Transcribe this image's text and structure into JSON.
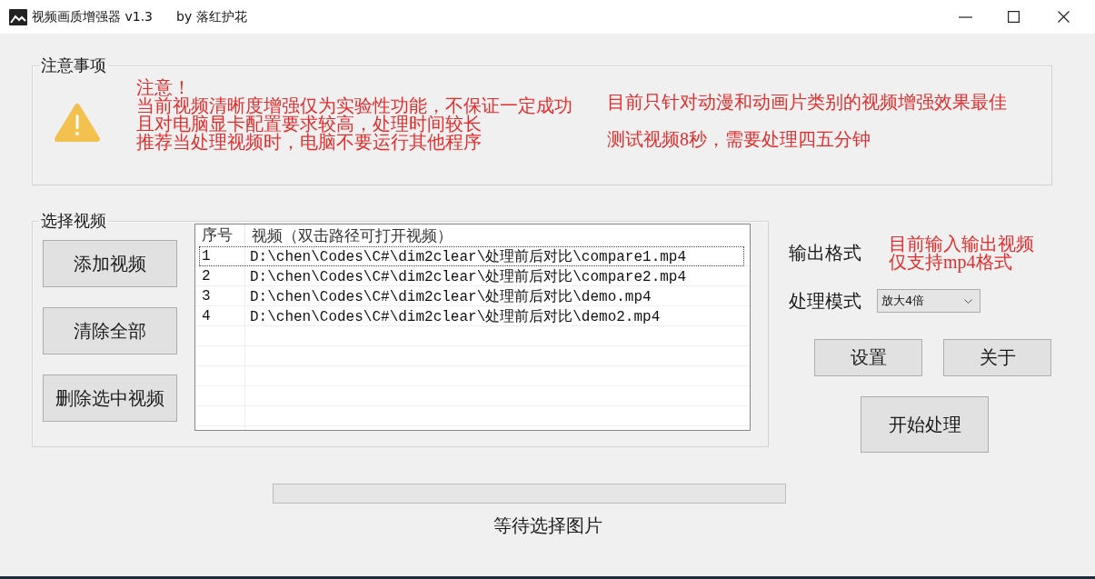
{
  "window": {
    "title": "视频画质增强器 v1.3",
    "author": "by 落红护花"
  },
  "notice": {
    "title": "注意事项",
    "warning_lines": [
      "注意！",
      "当前视频清晰度增强仅为实验性功能，不保证一定成功",
      "且对电脑显卡配置要求较高，处理时间较长",
      "推荐当处理视频时，电脑不要运行其他程序"
    ],
    "tips": [
      "目前只针对动漫和动画片类别的视频增强效果最佳",
      "测试视频8秒，需要处理四五分钟"
    ]
  },
  "video_group": {
    "title": "选择视频",
    "buttons": [
      "添加视频",
      "清除全部",
      "删除选中视频"
    ],
    "table": {
      "columns": [
        "序号",
        "视频（双击路径可打开视频）"
      ],
      "rows": [
        {
          "cells": [
            "1",
            "D:\\chen\\Codes\\C#\\dim2clear\\处理前后对比\\compare1.mp4"
          ],
          "focused": true
        },
        {
          "cells": [
            "2",
            "D:\\chen\\Codes\\C#\\dim2clear\\处理前后对比\\compare2.mp4"
          ],
          "focused": false
        },
        {
          "cells": [
            "3",
            "D:\\chen\\Codes\\C#\\dim2clear\\处理前后对比\\demo.mp4"
          ],
          "focused": false
        },
        {
          "cells": [
            "4",
            "D:\\chen\\Codes\\C#\\dim2clear\\处理前后对比\\demo2.mp4"
          ],
          "focused": false
        }
      ]
    }
  },
  "output": {
    "format_label": "输出格式",
    "format_note": [
      "目前输入输出视频",
      "仅支持mp4格式"
    ],
    "mode": {
      "label": "处理模式",
      "value": "放大4倍"
    },
    "buttons": [
      "设置",
      "关于"
    ],
    "start_button": "开始处理"
  },
  "progress": {
    "level": 0
  },
  "status": "等待选择图片"
}
